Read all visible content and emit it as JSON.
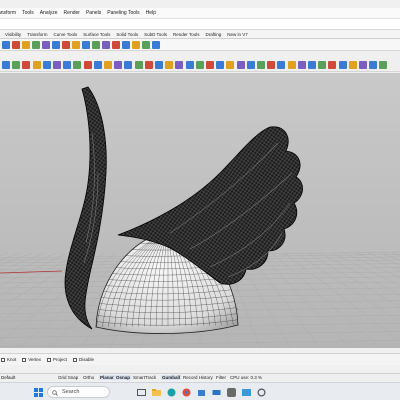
{
  "menu": [
    "ansform",
    "Tools",
    "Analyze",
    "Render",
    "Panels",
    "Paneling Tools",
    "Help"
  ],
  "toolbar_tabs": [
    "Visibility",
    "Transform",
    "Curve Tools",
    "Surface Tools",
    "Solid Tools",
    "SubD Tools",
    "Render Tools",
    "Drafting",
    "New in V7"
  ],
  "toolbar_icons": {
    "row1": [
      "#3a7bd5",
      "#d04a3a",
      "#e0a020",
      "#5aa05a",
      "#7a5fc0",
      "#3a7bd5",
      "#d04a3a",
      "#e0a020",
      "#3a7bd5",
      "#5aa05a",
      "#7a5fc0",
      "#d04a3a",
      "#3a7bd5",
      "#e0a020",
      "#5aa05a",
      "#3a7bd5"
    ],
    "row2": [
      "#3a7bd5",
      "#5aa05a",
      "#d04a3a",
      "#e0a020",
      "#3a7bd5",
      "#7a5fc0",
      "#3a7bd5",
      "#5aa05a",
      "#d04a3a",
      "#3a7bd5",
      "#e0a020",
      "#7a5fc0",
      "#3a7bd5",
      "#5aa05a",
      "#d04a3a",
      "#3a7bd5",
      "#e0a020",
      "#7a5fc0",
      "#3a7bd5",
      "#5aa05a",
      "#d04a3a",
      "#3a7bd5",
      "#e0a020",
      "#7a5fc0",
      "#3a7bd5",
      "#5aa05a",
      "#d04a3a",
      "#3a7bd5",
      "#e0a020",
      "#7a5fc0",
      "#3a7bd5",
      "#5aa05a",
      "#d04a3a",
      "#3a7bd5",
      "#e0a020",
      "#7a5fc0",
      "#3a7bd5",
      "#5aa05a"
    ]
  },
  "viewport": {
    "background_top": "#c9c9c9",
    "background_bottom": "#b5b5b5",
    "grid_color": "#a9a9a9",
    "wireframe_color": "#111111",
    "x_axis_color": "#b03030",
    "y_axis_color": "#3a8a3a"
  },
  "osnaps": [
    "Knot",
    "Vertex",
    "Project",
    "Disable"
  ],
  "status": {
    "layer": "Default",
    "items": [
      "Grid Snap",
      "Ortho",
      "Planar",
      "Osnap",
      "SmartTrack",
      "Gumball",
      "Record History",
      "Filter",
      "CPU use: 0.3 %"
    ],
    "active": [
      "Planar",
      "Osnap",
      "Gumball"
    ]
  },
  "taskbar": {
    "search_label": "Search",
    "icons": [
      "windows-start-icon",
      "search-icon",
      "task-view-icon",
      "file-explorer-icon",
      "edge-icon",
      "chrome-icon",
      "store-icon",
      "mail-icon",
      "rhino-icon",
      "photos-icon",
      "settings-icon"
    ]
  }
}
